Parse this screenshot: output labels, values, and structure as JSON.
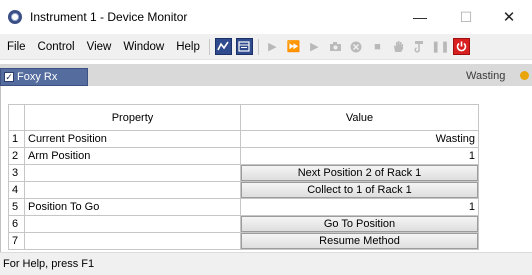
{
  "window": {
    "title": "Instrument 1 - Device Monitor",
    "minimize": "—",
    "maximize": "☐",
    "close": "✕"
  },
  "menu": [
    {
      "label": "File"
    },
    {
      "label": "Control"
    },
    {
      "label": "View"
    },
    {
      "label": "Window"
    },
    {
      "label": "Help"
    }
  ],
  "toolbar": {
    "icons": [
      "chart-icon",
      "dialog-icon",
      "play-icon",
      "fast-forward-icon",
      "step-icon",
      "camera-icon",
      "abort-icon",
      "stop-icon",
      "hand-icon",
      "hook-icon",
      "pause-icon",
      "power-icon"
    ]
  },
  "tab": {
    "label": "Foxy Rx",
    "checked": true,
    "status": "Wasting",
    "status_color": "#e8a60c"
  },
  "table": {
    "headers": {
      "property": "Property",
      "value": "Value"
    },
    "rows": [
      {
        "num": "1",
        "property": "Current Position",
        "value": "Wasting",
        "kind": "text"
      },
      {
        "num": "2",
        "property": "Arm Position",
        "value": "1",
        "kind": "text"
      },
      {
        "num": "3",
        "property": "",
        "value": "Next Position 2 of Rack 1",
        "kind": "button"
      },
      {
        "num": "4",
        "property": "",
        "value": "Collect to 1 of Rack 1",
        "kind": "button"
      },
      {
        "num": "5",
        "property": "Position To Go",
        "value": "1",
        "kind": "text"
      },
      {
        "num": "6",
        "property": "",
        "value": "Go To Position",
        "kind": "button"
      },
      {
        "num": "7",
        "property": "",
        "value": "Resume Method",
        "kind": "button"
      }
    ]
  },
  "statusbar": {
    "text": "For Help, press F1"
  }
}
